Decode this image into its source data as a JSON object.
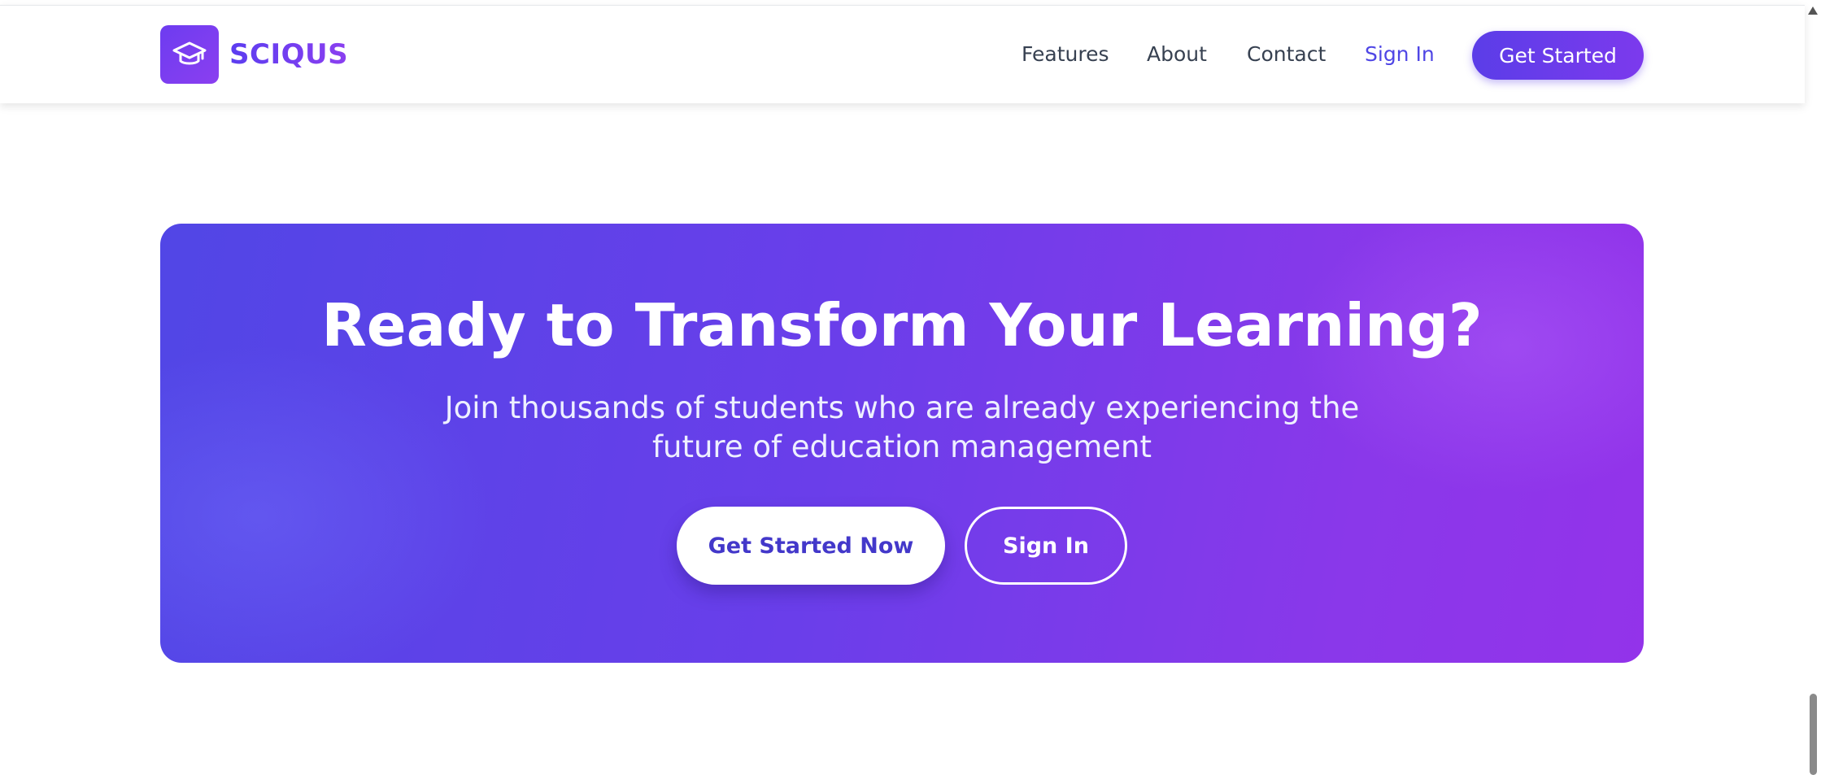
{
  "nav": {
    "brand": {
      "name": "SCIQUS",
      "logo_icon": "graduation-cap-icon"
    },
    "links": [
      {
        "label": "Features"
      },
      {
        "label": "About"
      },
      {
        "label": "Contact"
      },
      {
        "label": "Sign In"
      }
    ],
    "cta_label": "Get Started"
  },
  "cta": {
    "title": "Ready to Transform Your Learning?",
    "subtitle": "Join thousands of students who are already experiencing the future of education management",
    "primary_button": "Get Started Now",
    "secondary_button": "Sign In"
  },
  "colors": {
    "accent": "#5b3de8",
    "accent_secondary": "#9333ea",
    "nav_text": "#374151",
    "link_active": "#4f46e5"
  }
}
